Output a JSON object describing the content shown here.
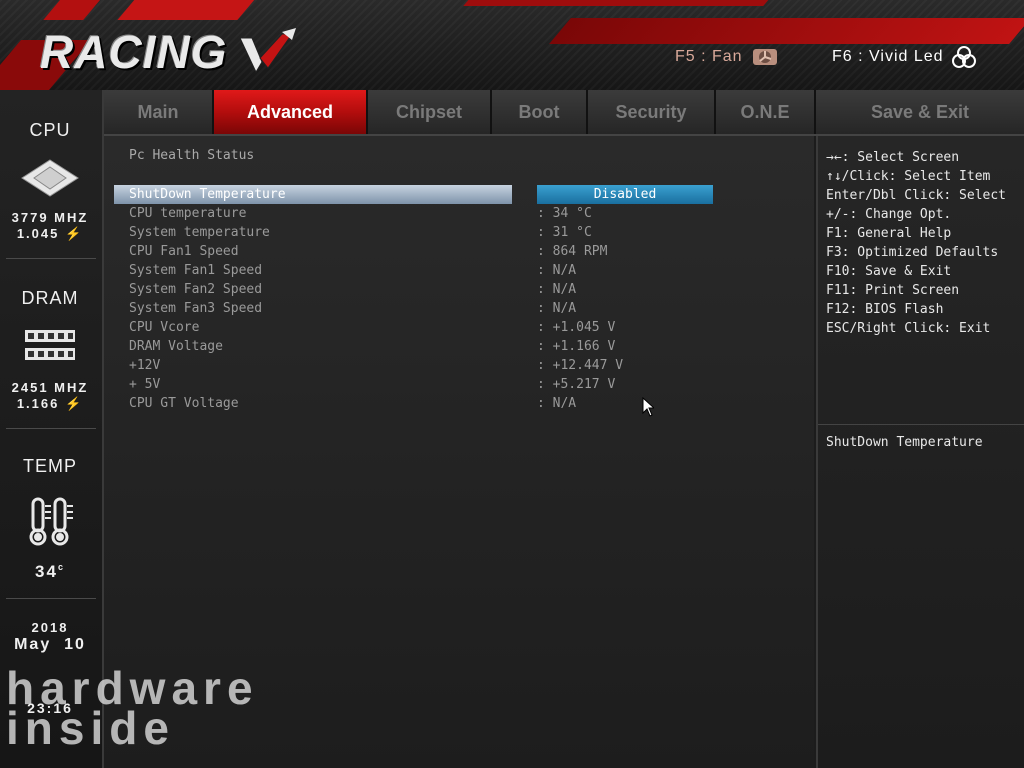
{
  "header": {
    "logo_text": "RACING",
    "hotkey_fan": "F5 : Fan",
    "hotkey_led": "F6 : Vivid Led",
    "colors": {
      "accent_red": "#c50f0f",
      "text": "#e9e9e9"
    }
  },
  "tabs": [
    {
      "label": "Main",
      "active": false
    },
    {
      "label": "Advanced",
      "active": true
    },
    {
      "label": "Chipset",
      "active": false
    },
    {
      "label": "Boot",
      "active": false
    },
    {
      "label": "Security",
      "active": false
    },
    {
      "label": "O.N.E",
      "active": false
    },
    {
      "label": "Save & Exit",
      "active": false
    }
  ],
  "sidebar": {
    "cpu": {
      "title": "CPU",
      "freq": "3779 MHZ",
      "volt": "1.045",
      "icon": "cpu-chip-icon"
    },
    "dram": {
      "title": "DRAM",
      "freq": "2451 MHZ",
      "volt": "1.166",
      "icon": "ram-module-icon"
    },
    "temp": {
      "title": "TEMP",
      "value": "34",
      "icon": "thermometer-icon"
    },
    "date": {
      "year": "2018",
      "month_day": "May  10",
      "time": "23:16"
    }
  },
  "main": {
    "section_title": "Pc Health Status",
    "selected_item": {
      "label": "ShutDown Temperature",
      "value": "Disabled"
    },
    "rows": [
      {
        "label": "CPU temperature",
        "value": ": 34 °C"
      },
      {
        "label": "System temperature",
        "value": ": 31 °C"
      },
      {
        "label": "CPU Fan1 Speed",
        "value": ": 864 RPM"
      },
      {
        "label": "System Fan1 Speed",
        "value": ": N/A"
      },
      {
        "label": "System Fan2 Speed",
        "value": ": N/A"
      },
      {
        "label": "System Fan3 Speed",
        "value": ": N/A"
      },
      {
        "label": "CPU Vcore",
        "value": ": +1.045 V"
      },
      {
        "label": "DRAM Voltage",
        "value": ": +1.166 V"
      },
      {
        "label": "+12V",
        "value": ": +12.447 V"
      },
      {
        "label": "+ 5V",
        "value": ": +5.217 V"
      },
      {
        "label": "CPU GT Voltage",
        "value": ": N/A"
      }
    ]
  },
  "help": {
    "keys": [
      "→←: Select Screen",
      "↑↓/Click: Select Item",
      "Enter/Dbl Click: Select",
      "+/-: Change Opt.",
      "F1: General Help",
      "F3: Optimized Defaults",
      "F10: Save & Exit",
      "F11: Print Screen",
      "F12: BIOS Flash",
      "ESC/Right Click: Exit"
    ],
    "description": "ShutDown Temperature"
  },
  "watermark": {
    "line1": "hardware",
    "line2": "inside"
  }
}
